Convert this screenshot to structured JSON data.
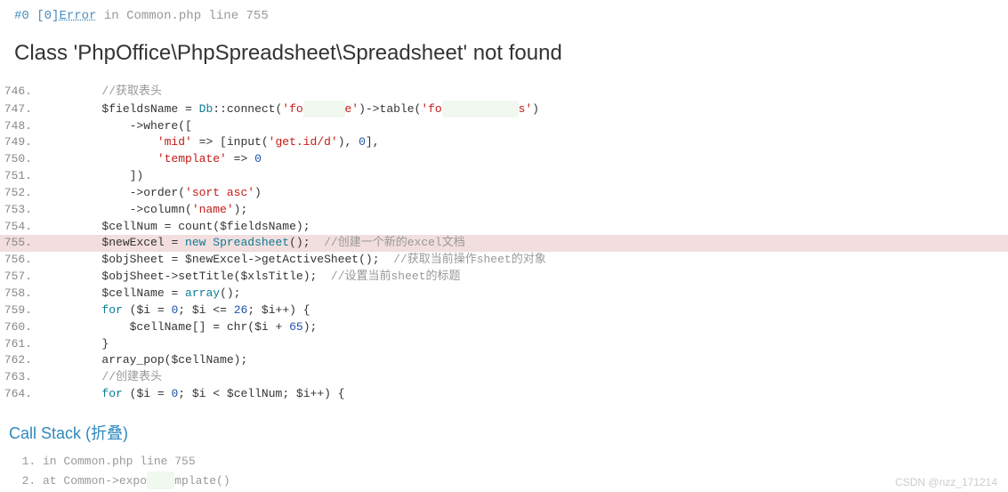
{
  "top": {
    "hash": "#0",
    "bracket": "[0]",
    "error_word": "Error",
    "in_word": "in",
    "file": "Common.php",
    "line_word": "line",
    "line_num": "755"
  },
  "title": "Class 'PhpOffice\\PhpSpreadsheet\\Spreadsheet' not found",
  "code_lines": [
    {
      "num": "746.",
      "hl": false,
      "html": "        <span class='c-comment'>//获取表头</span>"
    },
    {
      "num": "747.",
      "hl": false,
      "html": "        <span class='c-var'>$fieldsName</span> = <span class='c-name'>Db</span>::connect(<span class='c-string'>'fo</span><span class='obscure'>xxxxxx</span><span class='c-string'>e'</span>)->table(<span class='c-string'>'fo</span><span class='obscure'>xxxxxxxxxxx</span><span class='c-string'>s'</span>)"
    },
    {
      "num": "748.",
      "hl": false,
      "html": "            ->where(["
    },
    {
      "num": "749.",
      "hl": false,
      "html": "                <span class='c-string'>'mid'</span> => [input(<span class='c-string'>'get.id/d'</span>), <span class='c-num'>0</span>],"
    },
    {
      "num": "750.",
      "hl": false,
      "html": "                <span class='c-string'>'template'</span> => <span class='c-num'>0</span>"
    },
    {
      "num": "751.",
      "hl": false,
      "html": "            ])"
    },
    {
      "num": "752.",
      "hl": false,
      "html": "            ->order(<span class='c-string'>'sort asc'</span>)"
    },
    {
      "num": "753.",
      "hl": false,
      "html": "            ->column(<span class='c-string'>'name'</span>);"
    },
    {
      "num": "754.",
      "hl": false,
      "html": "        <span class='c-var'>$cellNum</span> = count(<span class='c-var'>$fieldsName</span>);"
    },
    {
      "num": "755.",
      "hl": true,
      "html": "        <span class='c-var'>$newExcel</span> = <span class='c-keyword'>new</span> <span class='c-name'>Spreadsheet</span>();  <span class='c-comment'>//创建一个新的excel文档</span>"
    },
    {
      "num": "756.",
      "hl": false,
      "html": "        <span class='c-var'>$objSheet</span> = <span class='c-var'>$newExcel</span>->getActiveSheet();  <span class='c-comment'>//获取当前操作sheet的对象</span>"
    },
    {
      "num": "757.",
      "hl": false,
      "html": "        <span class='c-var'>$objSheet</span>->setTitle(<span class='c-var'>$xlsTitle</span>);  <span class='c-comment'>//设置当前sheet的标题</span>"
    },
    {
      "num": "758.",
      "hl": false,
      "html": "        <span class='c-var'>$cellName</span> = <span class='c-keyword'>array</span>();"
    },
    {
      "num": "759.",
      "hl": false,
      "html": "        <span class='c-keyword'>for</span> (<span class='c-var'>$i</span> = <span class='c-num'>0</span>; <span class='c-var'>$i</span> <= <span class='c-num'>26</span>; <span class='c-var'>$i</span>++) {"
    },
    {
      "num": "760.",
      "hl": false,
      "html": "            <span class='c-var'>$cellName</span>[] = chr(<span class='c-var'>$i</span> + <span class='c-num'>65</span>);"
    },
    {
      "num": "761.",
      "hl": false,
      "html": "        }"
    },
    {
      "num": "762.",
      "hl": false,
      "html": "        array_pop(<span class='c-var'>$cellName</span>);"
    },
    {
      "num": "763.",
      "hl": false,
      "html": "        <span class='c-comment'>//创建表头</span>"
    },
    {
      "num": "764.",
      "hl": false,
      "html": "        <span class='c-keyword'>for</span> (<span class='c-var'>$i</span> = <span class='c-num'>0</span>; <span class='c-var'>$i</span> < <span class='c-var'>$cellNum</span>; <span class='c-var'>$i</span>++) {"
    }
  ],
  "call_stack_title": "Call Stack (折叠)",
  "stack": [
    {
      "text_prefix": "in ",
      "file": "Common.php",
      "line_word": "line",
      "line_num": "755"
    },
    {
      "text_prefix": "at ",
      "call": "Common->expo",
      "obscured": "xxxx",
      "suffix": "mplate()"
    }
  ],
  "watermark": "CSDN @nzz_171214"
}
